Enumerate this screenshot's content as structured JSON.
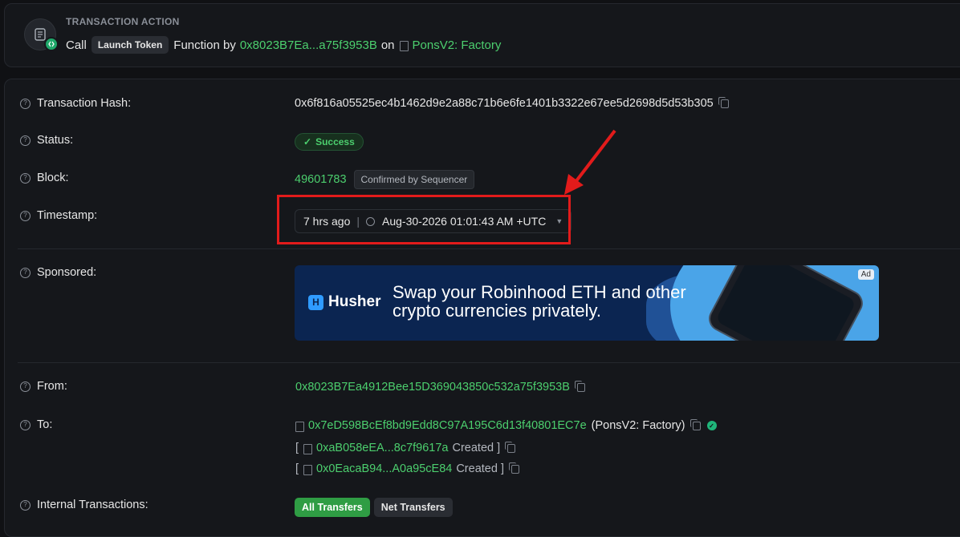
{
  "action": {
    "label": "TRANSACTION ACTION",
    "call": "Call",
    "method": "Launch Token",
    "function_by": "Function by",
    "from_short": "0x8023B7Ea...a75f3953B",
    "on": "on",
    "contract": "PonsV2: Factory"
  },
  "rows": {
    "hash_label": "Transaction Hash:",
    "hash_value": "0x6f816a05525ec4b1462d9e2a88c71b6e6fe1401b3322e67ee5d2698d5d53b305",
    "status_label": "Status:",
    "status_value": "Success",
    "block_label": "Block:",
    "block_value": "49601783",
    "block_badge": "Confirmed by Sequencer",
    "timestamp_label": "Timestamp:",
    "timestamp_ago": "7 hrs ago",
    "timestamp_date": "Aug-30-2026 01:01:43 AM +UTC",
    "sponsored_label": "Sponsored:",
    "from_label": "From:",
    "from_value": "0x8023B7Ea4912Bee15D369043850c532a75f3953B",
    "to_label": "To:",
    "to_value": "0x7eD598BcEf8bd9Edd8C97A195C6d13f40801EC7e",
    "to_name": "(PonsV2: Factory)",
    "created1_open": "[",
    "created1_addr": "0xaB058eEA...8c7f9617a",
    "created1_text": "Created ]",
    "created2_open": "[",
    "created2_addr": "0x0EacaB94...A0a95cE84",
    "created2_text": "Created ]",
    "internal_label": "Internal Transactions:",
    "tab_all": "All Transfers",
    "tab_net": "Net Transfers"
  },
  "ad": {
    "brand": "Husher",
    "line1": "Swap your Robinhood ETH and other",
    "line2": "crypto currencies privately.",
    "tag": "Ad"
  },
  "colors": {
    "accent_green": "#4ccf6e",
    "highlight_red": "#e21b1b"
  }
}
